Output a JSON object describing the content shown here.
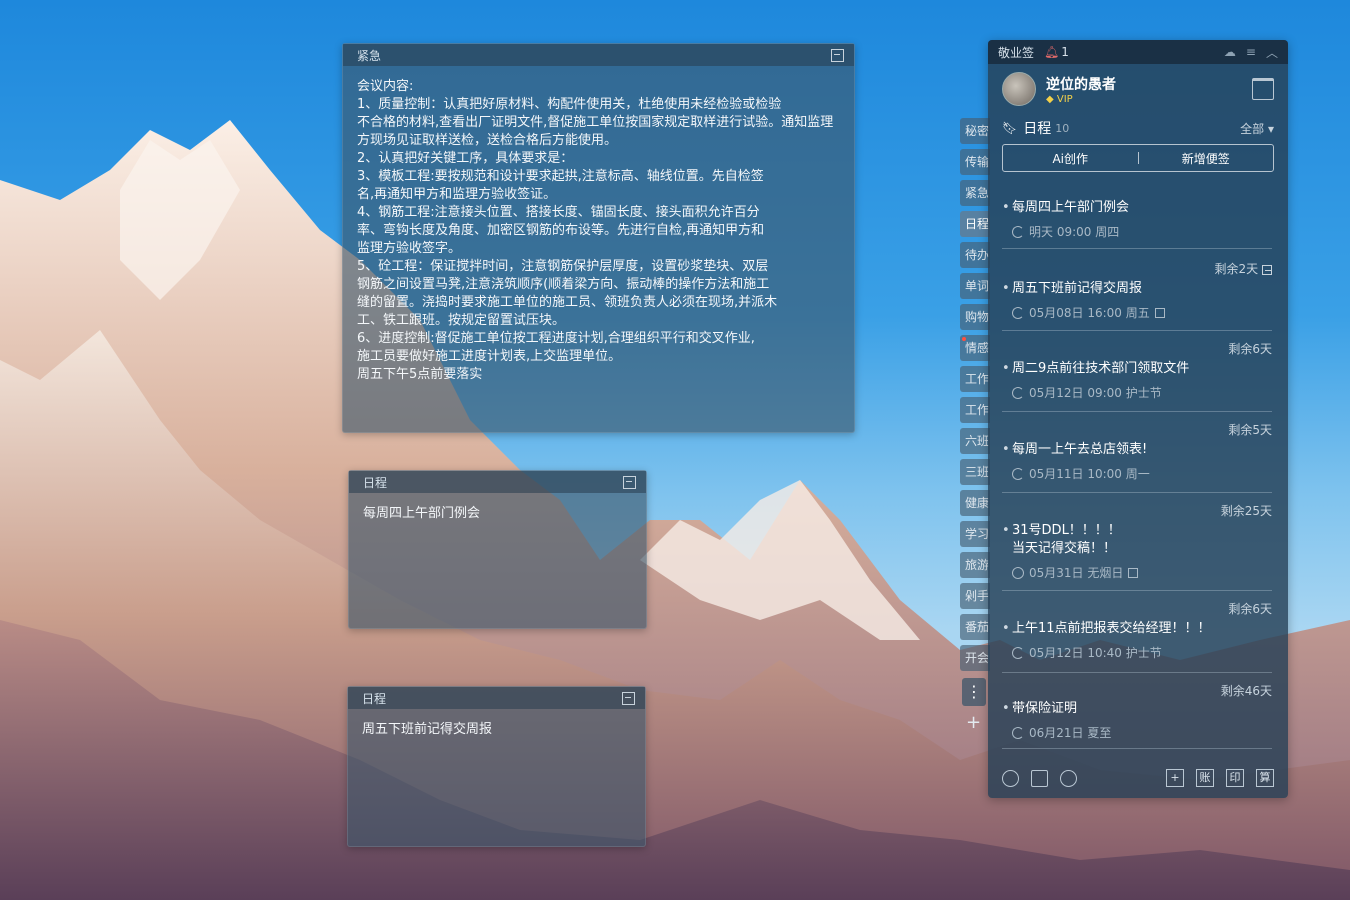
{
  "urgent_note": {
    "header": "紧急",
    "content": "会议内容:\n1、质量控制：认真把好原材料、构配件使用关，杜绝使用未经检验或检验\n不合格的材料,查看出厂证明文件,督促施工单位按国家规定取样进行试验。通知监理\n方现场见证取样送检，送检合格后方能使用。\n2、认真把好关键工序，具体要求是：\n3、模板工程:要按规范和设计要求起拱,注意标高、轴线位置。先自检签\n名,再通知甲方和监理方验收签证。\n4、钢筋工程:注意接头位置、搭接长度、锚固长度、接头面积允许百分\n率、弯钩长度及角度、加密区钢筋的布设等。先进行自检,再通知甲方和\n监理方验收签字。\n5、砼工程：保证搅拌时间，注意钢筋保护层厚度，设置砂浆垫块、双层\n钢筋之间设置马凳,注意浇筑顺序(顺着梁方向、振动棒的操作方法和施工\n缝的留置。浇捣时要求施工单位的施工员、领班负责人必须在现场,并派木\n工、铁工跟班。按规定留置试压块。\n6、进度控制:督促施工单位按工程进度计划,合理组织平行和交叉作业,\n施工员要做好施工进度计划表,上交监理单位。\n周五下午5点前要落实"
  },
  "note2": {
    "header": "日程",
    "content": "每周四上午部门例会"
  },
  "note3": {
    "header": "日程",
    "content": "周五下班前记得交周报"
  },
  "side_tabs": [
    {
      "label": "秘密",
      "active": false,
      "dot": false
    },
    {
      "label": "传输",
      "active": false,
      "dot": false
    },
    {
      "label": "紧急",
      "active": false,
      "dot": false
    },
    {
      "label": "日程",
      "active": true,
      "dot": false
    },
    {
      "label": "待办",
      "active": false,
      "dot": false
    },
    {
      "label": "单词",
      "active": false,
      "dot": false
    },
    {
      "label": "购物",
      "active": false,
      "dot": false
    },
    {
      "label": "情感",
      "active": false,
      "dot": true
    },
    {
      "label": "工作",
      "active": false,
      "dot": false
    },
    {
      "label": "工作",
      "active": false,
      "dot": false
    },
    {
      "label": "六班",
      "active": false,
      "dot": false
    },
    {
      "label": "三班",
      "active": false,
      "dot": false
    },
    {
      "label": "健康",
      "active": false,
      "dot": false
    },
    {
      "label": "学习",
      "active": false,
      "dot": false
    },
    {
      "label": "旅游",
      "active": false,
      "dot": false
    },
    {
      "label": "剁手",
      "active": false,
      "dot": false
    },
    {
      "label": "番茄",
      "active": false,
      "dot": false
    },
    {
      "label": "开会",
      "active": false,
      "dot": false
    }
  ],
  "panel": {
    "app_name": "敬业签",
    "notification_count": "1",
    "user_name": "逆位的愚者",
    "vip": "VIP",
    "section_title": "日程",
    "section_count": "10",
    "filter": "全部",
    "ai_button": "Ai创作",
    "new_note_button": "新增便签",
    "items": [
      {
        "remaining": "",
        "title": "每周四上午部门例会",
        "meta": "明天 09:00 周四"
      },
      {
        "remaining": "剩余2天",
        "title": "周五下班前记得交周报",
        "meta": "05月08日 16:00 周五"
      },
      {
        "remaining": "剩余6天",
        "title": "周二9点前往技术部门领取文件",
        "meta": "05月12日 09:00 护士节"
      },
      {
        "remaining": "剩余5天",
        "title": "每周一上午去总店领表!",
        "meta": "05月11日 10:00 周一"
      },
      {
        "remaining": "剩余25天",
        "title": "31号DDL！！！！\n当天记得交稿！！",
        "meta": "05月31日 无烟日"
      },
      {
        "remaining": "剩余6天",
        "title": "上午11点前把报表交给经理！！！",
        "meta": "05月12日 10:40 护士节"
      },
      {
        "remaining": "剩余46天",
        "title": "带保险证明",
        "meta": "06月21日 夏至"
      }
    ],
    "bottom_boxes": [
      "+",
      "账",
      "印",
      "算"
    ]
  },
  "colors": {
    "panel_bg": "#26405680",
    "accent_vip": "#f2d04a",
    "tab_dot": "#ff5040"
  }
}
